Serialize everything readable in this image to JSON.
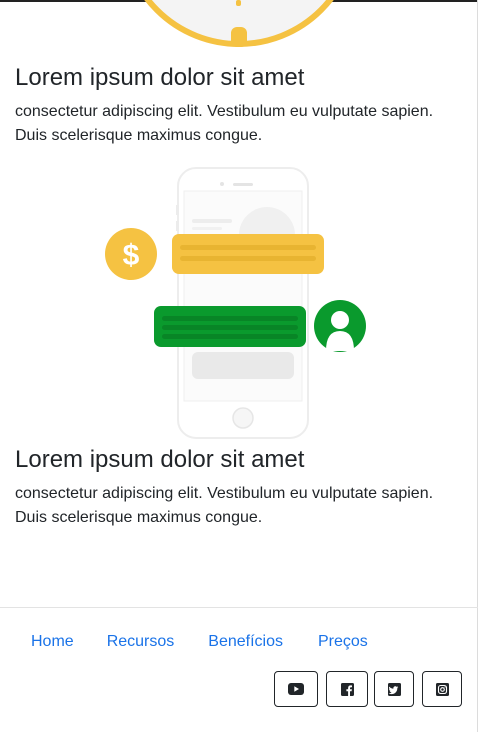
{
  "sections": [
    {
      "title": "Lorem ipsum dolor sit amet",
      "text": "consectetur adipiscing elit. Vestibulum eu vulputate sapien. Duis scelerisque maximus congue."
    },
    {
      "title": "Lorem ipsum dolor sit amet",
      "text": "consectetur adipiscing elit. Vestibulum eu vulputate sapien. Duis scelerisque maximus congue."
    }
  ],
  "illustration": {
    "dollar_symbol": "$",
    "colors": {
      "yellow": "#f5c242",
      "green": "#0a9a2d",
      "phone": "#f1f1f1"
    }
  },
  "footer": {
    "nav": [
      "Home",
      "Recursos",
      "Benefícios",
      "Preços"
    ],
    "social": [
      "youtube-icon",
      "facebook-icon",
      "twitter-icon",
      "instagram-icon"
    ]
  }
}
